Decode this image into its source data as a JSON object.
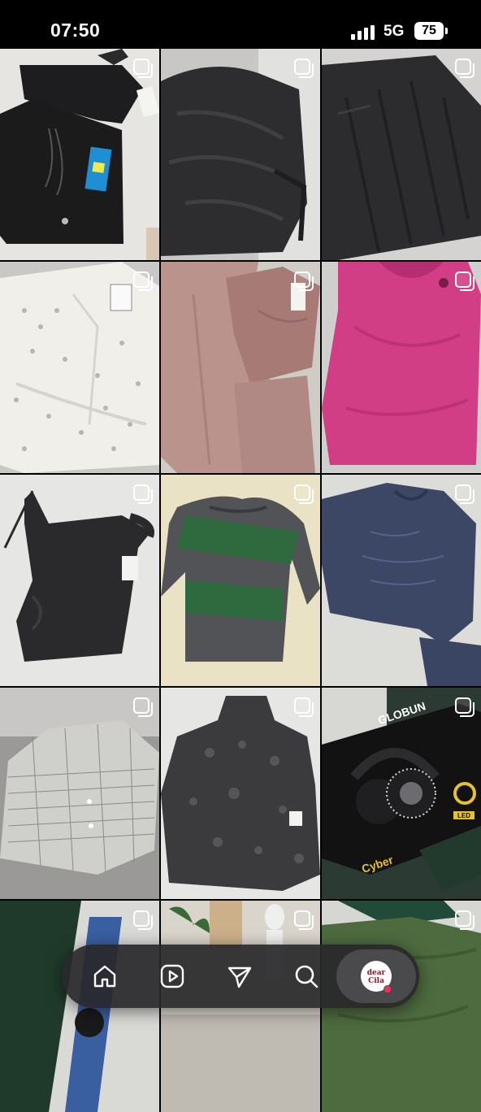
{
  "status_bar": {
    "time": "07:50",
    "network": "5G",
    "battery": "75"
  },
  "grid": {
    "tiles": [
      {
        "subject": "black crop top and shorts set with tags",
        "multi": true
      },
      {
        "subject": "black ruched wrap top",
        "multi": true
      },
      {
        "subject": "black pleated skirt",
        "multi": true
      },
      {
        "subject": "white eyelet lace blouse",
        "multi": true
      },
      {
        "subject": "dusty pink top and trousers set",
        "multi": true
      },
      {
        "subject": "pink sleeveless top",
        "multi": true
      },
      {
        "subject": "black one-shoulder top",
        "multi": true
      },
      {
        "subject": "green and grey striped sweater",
        "multi": true
      },
      {
        "subject": "navy embroidered blouse",
        "multi": true
      },
      {
        "subject": "tweed cropped jacket",
        "multi": true
      },
      {
        "subject": "dark lace long-sleeve top",
        "multi": true
      },
      {
        "subject": "Cyber LED gaming headset box",
        "multi": true
      },
      {
        "subject": "wristwatch on green surface",
        "multi": true
      },
      {
        "subject": "mannequin and plants",
        "multi": true
      },
      {
        "subject": "green set",
        "multi": true
      }
    ],
    "box_brand": "GLOBUN",
    "box_product": "Cyber",
    "box_badge": "LED"
  },
  "nav": {
    "items": [
      {
        "name": "home",
        "icon": "home-icon"
      },
      {
        "name": "reels",
        "icon": "reels-icon"
      },
      {
        "name": "share",
        "icon": "paper-plane-icon"
      },
      {
        "name": "search",
        "icon": "search-icon"
      },
      {
        "name": "profile",
        "icon": "avatar"
      }
    ],
    "avatar_text": "dear Cila"
  },
  "colors": {
    "status_bg": "#000000",
    "nav_bg": "#28282a",
    "notification": "#ff2d55"
  }
}
